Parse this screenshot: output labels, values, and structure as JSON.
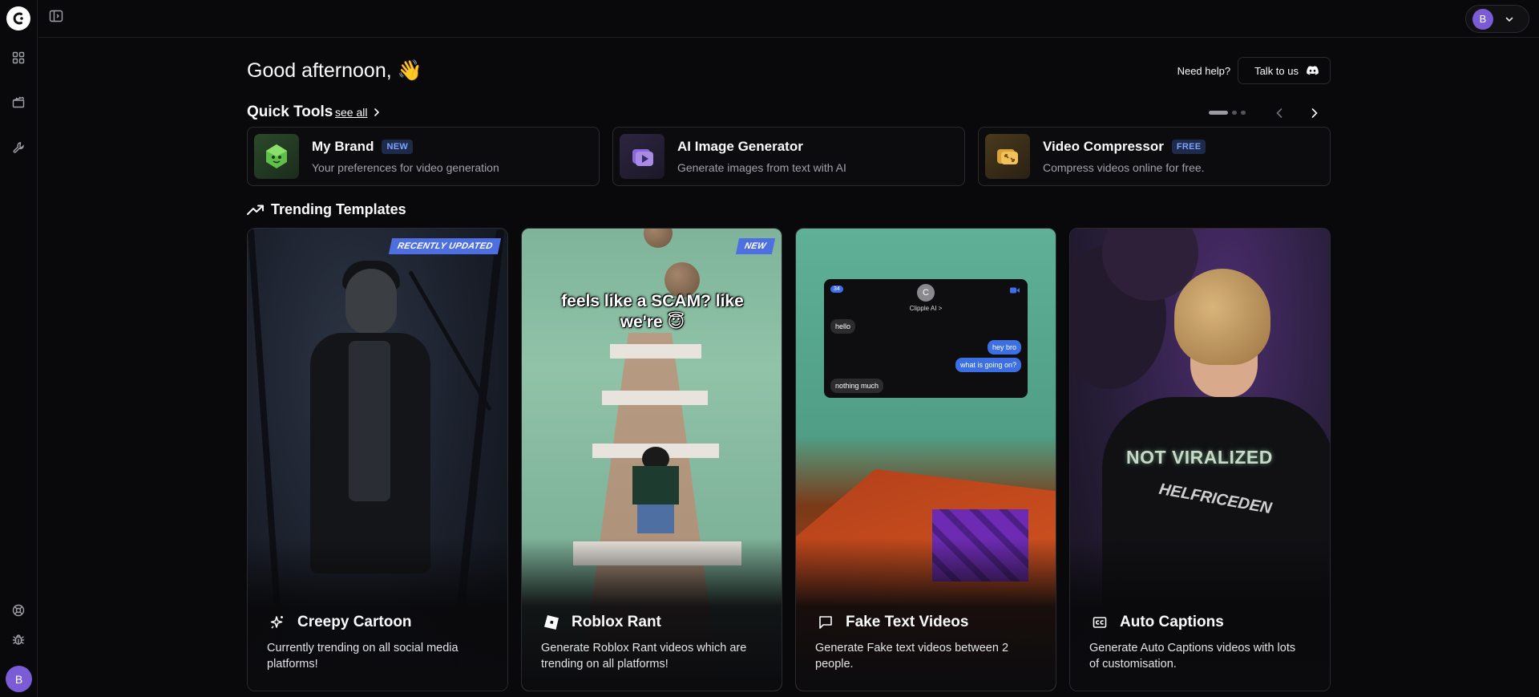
{
  "sidebar": {
    "avatar_initial": "B",
    "items": [
      {
        "name": "dashboard-icon"
      },
      {
        "name": "clapperboard-icon"
      },
      {
        "name": "wrench-icon"
      }
    ],
    "bottom_items": [
      {
        "name": "help-circle-icon"
      },
      {
        "name": "bug-icon"
      }
    ]
  },
  "topbar": {
    "user_initial": "B"
  },
  "header": {
    "greeting": "Good afternoon, 👋",
    "help_text": "Need help?",
    "talk_button": "Talk to us"
  },
  "quick_tools": {
    "title": "Quick Tools",
    "see_all": "see all",
    "cards": [
      {
        "name": "My Brand",
        "badge": "NEW",
        "description": "Your preferences for video generation",
        "icon": "brand-gem-icon"
      },
      {
        "name": "AI Image Generator",
        "badge": "",
        "description": "Generate images from text with AI",
        "icon": "image-generator-icon"
      },
      {
        "name": "Video Compressor",
        "badge": "FREE",
        "description": "Compress videos online for free.",
        "icon": "compressor-icon"
      }
    ]
  },
  "trending": {
    "title": "Trending Templates",
    "templates": [
      {
        "title": "Creepy Cartoon",
        "description": "Currently trending on all social media platforms!",
        "badge": "RECENTLY UPDATED",
        "icon": "sparkles-icon"
      },
      {
        "title": "Roblox Rant",
        "description": "Generate Roblox Rant videos which are trending on all platforms!",
        "badge": "NEW",
        "icon": "roblox-icon",
        "caption": "feels like a SCAM? like we're 😇"
      },
      {
        "title": "Fake Text Videos",
        "description": "Generate Fake text videos between 2 people.",
        "badge": "",
        "icon": "message-square-icon",
        "phone": {
          "count": "34",
          "avatar": "C",
          "contact": "Clipple AI >",
          "messages": [
            "hello",
            "hey bro",
            "what is going on?",
            "nothing much"
          ]
        }
      },
      {
        "title": "Auto Captions",
        "description": "Generate Auto Captions videos with lots of customisation.",
        "badge": "",
        "icon": "closed-captions-icon",
        "caption": "NOT VIRALIZED",
        "shirt_text": "HELFRICEDEN"
      }
    ]
  },
  "colors": {
    "background": "#09090b",
    "border": "#2a2a2f",
    "badge_bg": "#1e2a4a",
    "badge_text": "#7ea2ff",
    "accent_blue": "#4d6fe0",
    "avatar_purple": "#7c5cd6"
  }
}
